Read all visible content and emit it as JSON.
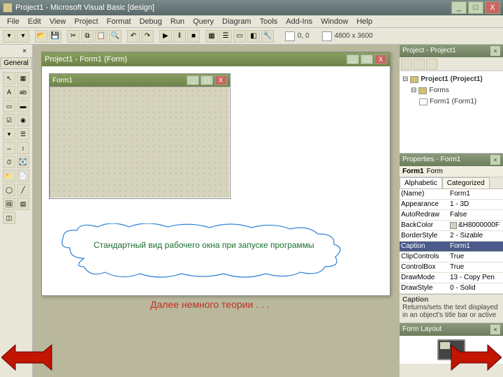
{
  "window": {
    "title": "Project1 - Microsoft Visual Basic [design]"
  },
  "menu": [
    "File",
    "Edit",
    "View",
    "Project",
    "Format",
    "Debug",
    "Run",
    "Query",
    "Diagram",
    "Tools",
    "Add-Ins",
    "Window",
    "Help"
  ],
  "coords": {
    "pos": "0, 0",
    "size": "4800 x 3600"
  },
  "toolbox": {
    "tab": "General"
  },
  "designer": {
    "title": "Project1 - Form1 (Form)",
    "form_title": "Form1"
  },
  "project": {
    "panel_title": "Project - Project1",
    "root": "Project1 (Project1)",
    "folder": "Forms",
    "item": "Form1 (Form1)"
  },
  "properties": {
    "panel_title": "Properties - Form1",
    "object_name": "Form1",
    "object_type": "Form",
    "tab_alpha": "Alphabetic",
    "tab_cat": "Categorized",
    "rows": [
      {
        "k": "(Name)",
        "v": "Form1"
      },
      {
        "k": "Appearance",
        "v": "1 - 3D"
      },
      {
        "k": "AutoRedraw",
        "v": "False"
      },
      {
        "k": "BackColor",
        "v": "&H8000000F"
      },
      {
        "k": "BorderStyle",
        "v": "2 - Sizable"
      },
      {
        "k": "Caption",
        "v": "Form1"
      },
      {
        "k": "ClipControls",
        "v": "True"
      },
      {
        "k": "ControlBox",
        "v": "True"
      },
      {
        "k": "DrawMode",
        "v": "13 - Copy Pen"
      },
      {
        "k": "DrawStyle",
        "v": "0 - Solid"
      }
    ],
    "desc_title": "Caption",
    "desc_text": "Returns/sets the text displayed in an object's title bar or active"
  },
  "form_layout": {
    "title": "Form Layout"
  },
  "callout": {
    "text": "Стандартный вид рабочего окна при запуске программы"
  },
  "bottom": {
    "text": "Далее немного теории . . ."
  },
  "nav": {
    "back": "назад",
    "forward": "вперед"
  }
}
